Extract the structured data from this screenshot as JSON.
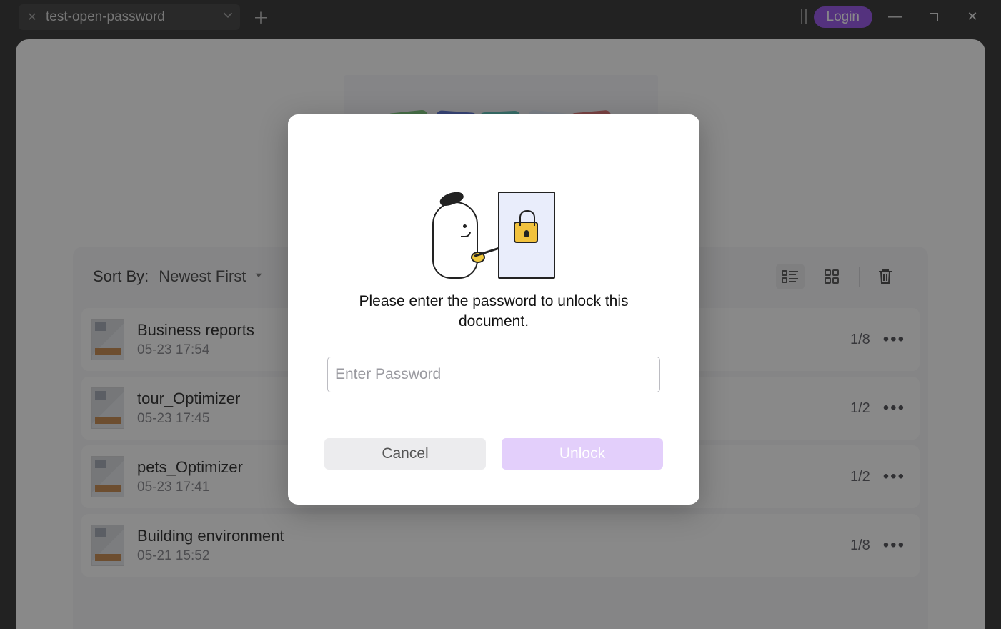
{
  "titlebar": {
    "tab_title": "test-open-password",
    "login_label": "Login"
  },
  "sort": {
    "label": "Sort By:",
    "value": "Newest First"
  },
  "documents": [
    {
      "title": "Business reports",
      "date": "05-23 17:54",
      "pages": "1/8"
    },
    {
      "title": "tour_Optimizer",
      "date": "05-23 17:45",
      "pages": "1/2"
    },
    {
      "title": "pets_Optimizer",
      "date": "05-23 17:41",
      "pages": "1/2"
    },
    {
      "title": "Building environment",
      "date": "05-21 15:52",
      "pages": "1/8"
    }
  ],
  "modal": {
    "message": "Please enter the password to unlock this document.",
    "placeholder": "Enter Password",
    "cancel": "Cancel",
    "unlock": "Unlock"
  }
}
